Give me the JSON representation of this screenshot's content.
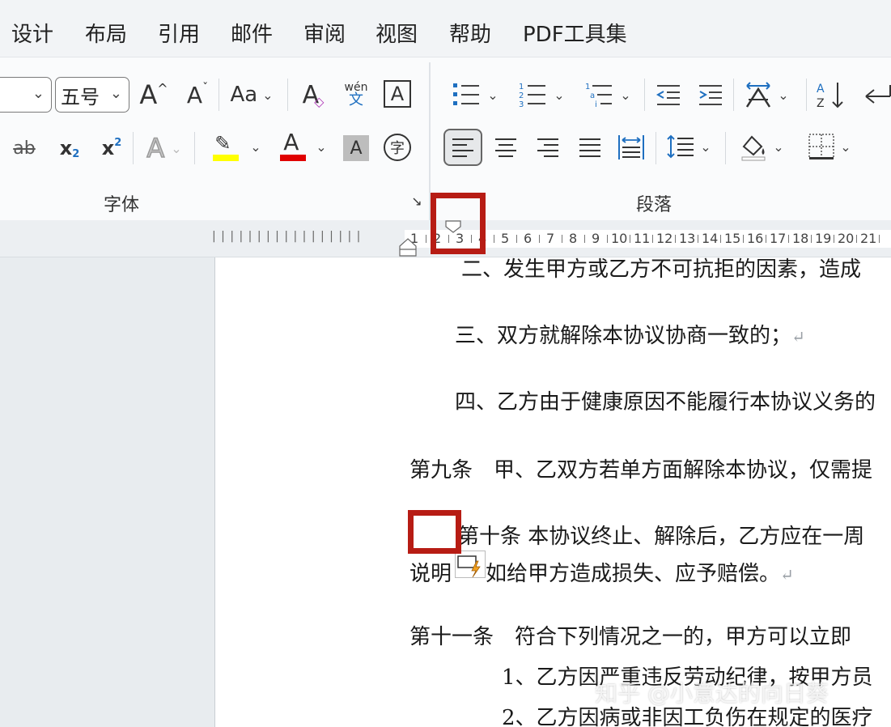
{
  "menu": [
    "设计",
    "布局",
    "引用",
    "邮件",
    "审阅",
    "视图",
    "帮助",
    "PDF工具集"
  ],
  "font_group": {
    "label": "字体",
    "font_size_value": "五号",
    "grow_font": "A",
    "shrink_font": "A",
    "change_case": "Aa",
    "phonetic_top": "wén",
    "phonetic_bottom": "文",
    "char_border": "A",
    "subscript": "x",
    "sub_mark": "2",
    "superscript": "x",
    "sup_mark": "2",
    "strikethrough": "ab",
    "text_effect": "A",
    "font_color": "A",
    "char_shading": "A",
    "enclose": "字"
  },
  "paragraph_group": {
    "label": "段落"
  },
  "colors": {
    "highlight_yellow": "#ffff00",
    "font_red": "#e00000",
    "accent_blue": "#1e6fc0",
    "annotation_red": "#b71c14"
  },
  "ruler": {
    "left_marks": "| | | | | | | | | | | | | | | | |",
    "numbers": [
      "1",
      "2",
      "3",
      "4",
      "5",
      "6",
      "7",
      "8",
      "9",
      "10",
      "11",
      "12",
      "13",
      "14",
      "15",
      "16",
      "17",
      "18",
      "19",
      "20",
      "21"
    ]
  },
  "document": {
    "lines": [
      "二、发生甲方或乙方不可抗拒的因素，造成",
      "三、双方就解除本协议协商一致的；",
      "四、乙方由于健康原因不能履行本协议义务的",
      "第九条　甲、乙双方若单方面解除本协议，仅需提",
      "第十条  本协议终止、解除后，乙方应在一周",
      "说明",
      "如给甲方造成损失、应予赔偿。",
      "第十一条　符合下列情况之一的，甲方可以立即",
      "1、乙方因严重违反劳动纪律，按甲方员",
      "2、乙方因病或非因工负伤在规定的医疗"
    ],
    "para_mark": "↵"
  },
  "watermark": "知乎 @小意达的向日葵"
}
